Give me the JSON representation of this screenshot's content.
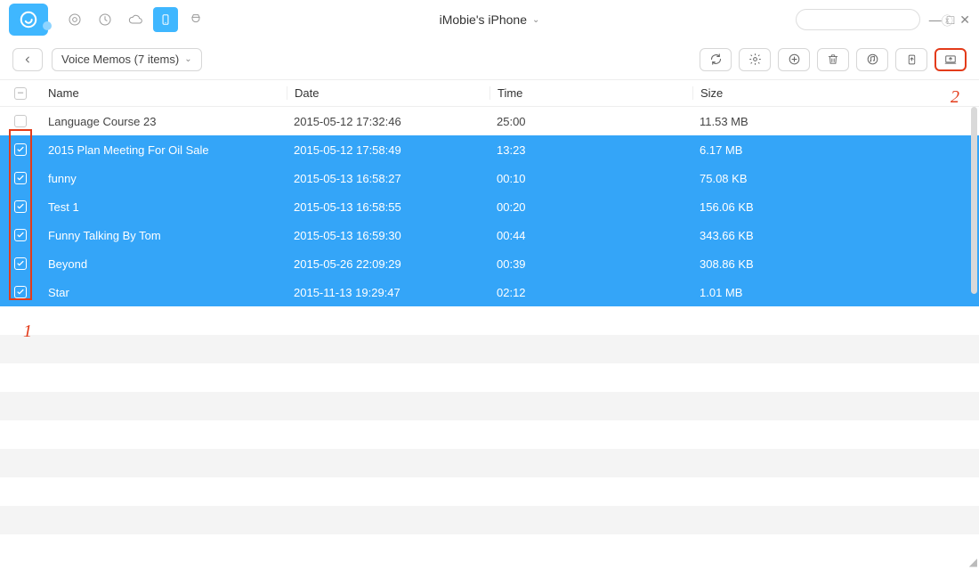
{
  "title": "iMobie's iPhone",
  "search": {
    "placeholder": ""
  },
  "breadcrumb": {
    "label": "Voice Memos (7 items)"
  },
  "columns": {
    "name": "Name",
    "date": "Date",
    "time": "Time",
    "size": "Size"
  },
  "rows": [
    {
      "selected": false,
      "name": "Language Course 23",
      "date": "2015-05-12 17:32:46",
      "time": "25:00",
      "size": "11.53 MB"
    },
    {
      "selected": true,
      "name": "2015 Plan Meeting For Oil Sale",
      "date": "2015-05-12 17:58:49",
      "time": "13:23",
      "size": "6.17 MB"
    },
    {
      "selected": true,
      "name": "funny",
      "date": "2015-05-13 16:58:27",
      "time": "00:10",
      "size": "75.08 KB"
    },
    {
      "selected": true,
      "name": "Test 1",
      "date": "2015-05-13 16:58:55",
      "time": "00:20",
      "size": "156.06 KB"
    },
    {
      "selected": true,
      "name": "Funny Talking By Tom",
      "date": "2015-05-13 16:59:30",
      "time": "00:44",
      "size": "343.66 KB"
    },
    {
      "selected": true,
      "name": "Beyond",
      "date": "2015-05-26 22:09:29",
      "time": "00:39",
      "size": "308.86 KB"
    },
    {
      "selected": true,
      "name": "Star",
      "date": "2015-11-13 19:29:47",
      "time": "02:12",
      "size": "1.01 MB"
    }
  ],
  "annotations": {
    "one": "1",
    "two": "2"
  }
}
